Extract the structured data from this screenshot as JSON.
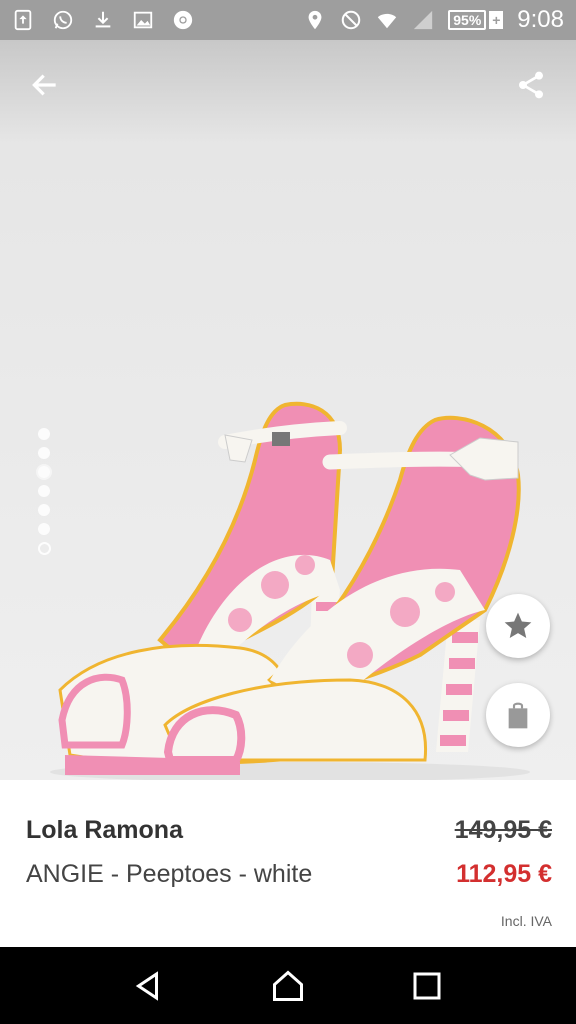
{
  "status_bar": {
    "battery_percent": "95%",
    "battery_plus": "+",
    "time": "9:08",
    "left_icons": [
      "upload-icon",
      "whatsapp-icon",
      "download-icon",
      "gallery-icon",
      "chrome-icon"
    ],
    "right_icons": [
      "location-icon",
      "no-disturb-icon",
      "wifi-icon",
      "signal-icon"
    ]
  },
  "gallery": {
    "dot_count": 7,
    "active_index": 2
  },
  "product": {
    "brand": "Lola Ramona",
    "name": "ANGIE - Peeptoes - white",
    "old_price": "149,95 €",
    "new_price": "112,95 €",
    "tax_note": "Incl. IVA"
  },
  "colors": {
    "sale_price": "#d32f2f",
    "status_bar": "#9e9e9e",
    "shoe_pink": "#f08fb4",
    "shoe_white": "#f7f5f0",
    "shoe_trim": "#f0b530"
  },
  "actions": {
    "wishlist_icon": "star-icon",
    "cart_icon": "shopping-bag-icon",
    "back_icon": "arrow-left-icon",
    "share_icon": "share-icon"
  }
}
